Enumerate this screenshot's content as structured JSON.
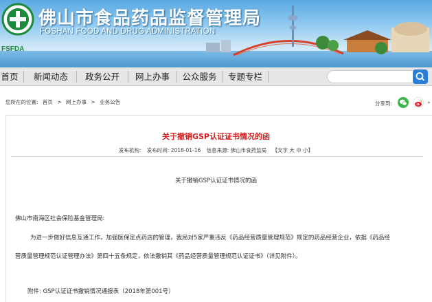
{
  "header": {
    "title_cn": "佛山市食品药品监督管理局",
    "title_en": "FOSHAN FOOD AND DRUG ADMINISTRATION",
    "logo_text": "FSFDA",
    "brand_color": "#1b8a3a"
  },
  "nav": {
    "items": [
      {
        "label": "首页"
      },
      {
        "label": "新闻动态"
      },
      {
        "label": "政务公开"
      },
      {
        "label": "网上办事"
      },
      {
        "label": "公众服务"
      },
      {
        "label": "专题专栏"
      }
    ],
    "search": {
      "placeholder": "",
      "icon": "search-icon"
    }
  },
  "breadcrumb": {
    "label": "您所在的位置:",
    "items": [
      "首页",
      ">",
      "网上办事",
      ">",
      "业务公告"
    ]
  },
  "share": {
    "label": "分享到:",
    "icons": [
      "wechat-icon",
      "weibo-icon"
    ]
  },
  "article": {
    "title": "关于撤销GSP认证证书情况的函",
    "meta": {
      "publish_org": "发布机构:",
      "publish_time": "发布时间: 2018-01-16",
      "source": "信息来源: 佛山市食药监局",
      "font_size": "【文字 大 中 小】"
    },
    "subtitle": "关于撤销GSP认证证书情况的函",
    "addressee": "佛山市南海区社会保险基金管理局:",
    "para1": "为进一步做好信息互通工作，加强医保定点药店的管理，我局对5家严重违反《药品经营质量管理规范》规定的药品经营企业，依据《药品经",
    "para2": "营质量管理规范认证管理办法》第四十五条规定，依法撤销其《药品经营质量管理规范认证证书》（详见附件）。",
    "attachment": "附件: GSP认证证书撤销情况通报表（2018年第001号）",
    "title_color": "#d62020"
  }
}
